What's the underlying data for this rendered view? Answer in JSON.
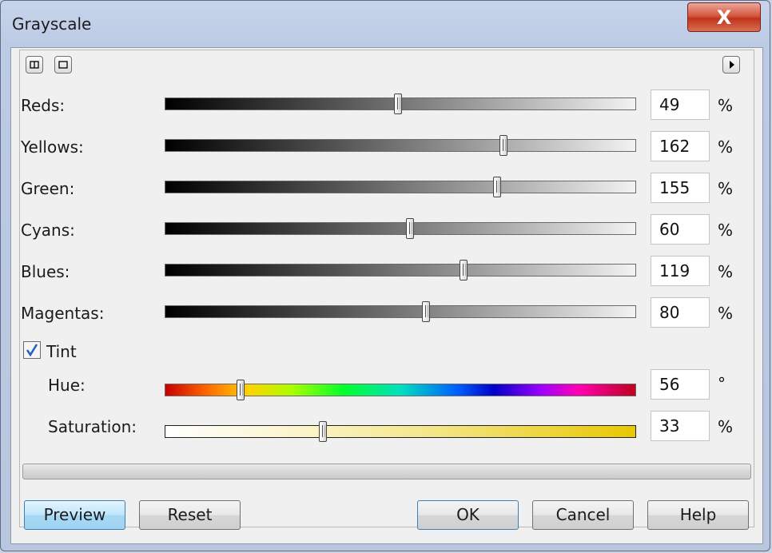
{
  "window": {
    "title": "Grayscale",
    "close_glyph": "X"
  },
  "toolbar": {
    "icons": [
      "split-view-icon",
      "single-view-icon",
      "flyout-arrow-icon"
    ]
  },
  "sliders": [
    {
      "label": "Reds:",
      "value": "49",
      "unit": "%",
      "level": 0.495
    },
    {
      "label": "Yellows:",
      "value": "162",
      "unit": "%",
      "level": 0.72
    },
    {
      "label": "Green:",
      "value": "155",
      "unit": "%",
      "level": 0.705
    },
    {
      "label": "Cyans:",
      "value": "60",
      "unit": "%",
      "level": 0.52
    },
    {
      "label": "Blues:",
      "value": "119",
      "unit": "%",
      "level": 0.635
    },
    {
      "label": "Magentas:",
      "value": "80",
      "unit": "%",
      "level": 0.555
    }
  ],
  "tint": {
    "label": "Tint",
    "checked": true,
    "hue": {
      "label": "Hue:",
      "value": "56",
      "unit": "°",
      "level": 0.16
    },
    "saturation": {
      "label": "Saturation:",
      "value": "33",
      "unit": "%",
      "level": 0.335
    }
  },
  "buttons": {
    "preview": "Preview",
    "reset": "Reset",
    "ok": "OK",
    "cancel": "Cancel",
    "help": "Help"
  }
}
